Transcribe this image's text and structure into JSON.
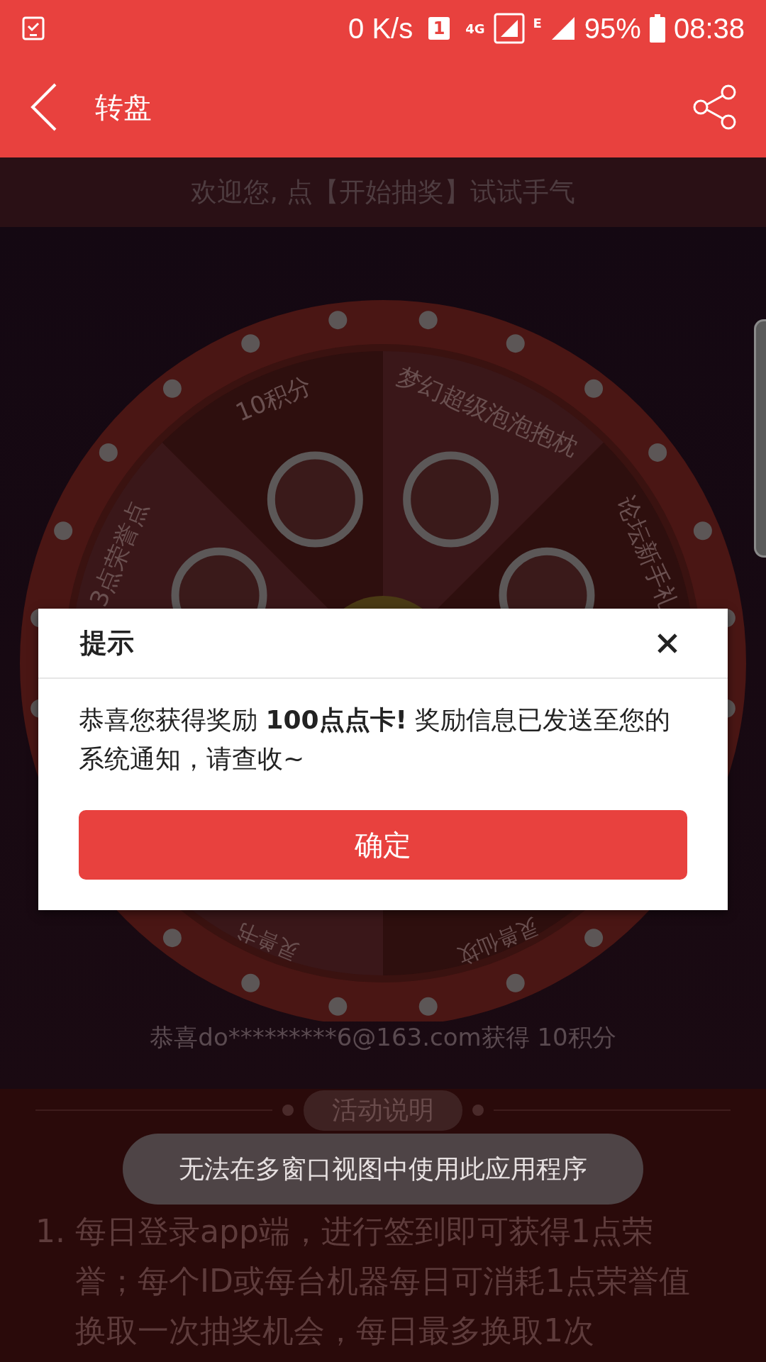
{
  "status_bar": {
    "network_speed": "0 K/s",
    "sim_badge": "1",
    "network_type": "4G",
    "network_type_2": "E",
    "battery": "95%",
    "time": "08:38"
  },
  "app_bar": {
    "title": "转盘"
  },
  "welcome_text": "欢迎您, 点【开始抽奖】试试手气",
  "wheel": {
    "segments": [
      {
        "label": "3点荣誉点"
      },
      {
        "label": "10积分"
      },
      {
        "label": "梦幻超级泡泡抱枕"
      },
      {
        "label": "论坛新手礼"
      },
      {
        "label": "灵兽仙坟"
      },
      {
        "label": "灵兽书"
      }
    ]
  },
  "winner_ticker": "恭喜do*********6@163.com获得 10积分",
  "rules": {
    "heading": "活动说明",
    "items": [
      {
        "number": "1.",
        "text": "每日登录app端，进行签到即可获得1点荣誉；每个ID或每台机器每日可消耗1点荣誉值换取一次抽奖机会，每日最多换取1次"
      }
    ]
  },
  "dialog": {
    "title": "提示",
    "message": "恭喜您获得奖励 **100点点卡!** 奖励信息已发送至您的系统通知，请查收~",
    "confirm_button": "确定"
  },
  "toast": "无法在多窗口视图中使用此应用程序"
}
